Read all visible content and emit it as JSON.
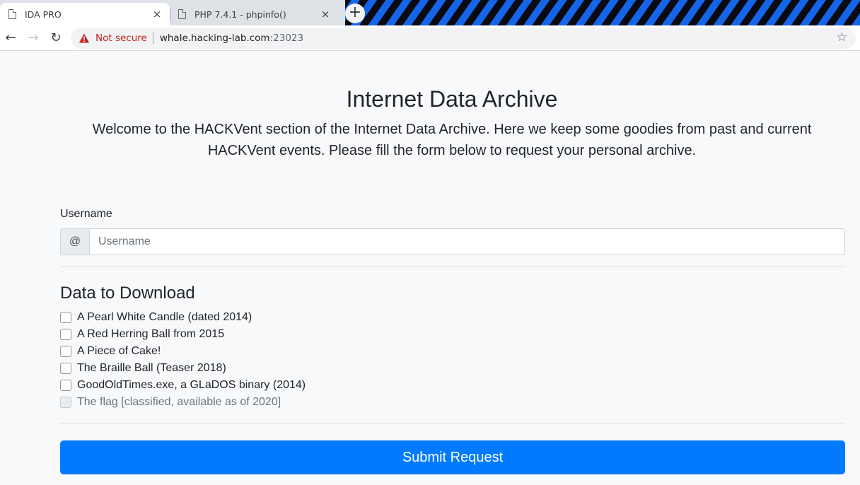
{
  "browser": {
    "tabs": [
      {
        "title": "IDA PRO",
        "active": true
      },
      {
        "title": "PHP 7.4.1 - phpinfo()",
        "active": false
      }
    ],
    "close_glyph": "×",
    "new_tab_glyph": "+",
    "nav": {
      "back_glyph": "←",
      "forward_glyph": "→",
      "reload_glyph": "↻"
    },
    "security_label": "Not secure",
    "url_host": "whale.hacking-lab.com",
    "url_port": ":23023",
    "bookmark_glyph": "☆"
  },
  "page": {
    "title": "Internet Data Archive",
    "lead": "Welcome to the HACKVent section of the Internet Data Archive. Here we keep some goodies from past and current HACKVent events. Please fill the form below to request your personal archive.",
    "username_label": "Username",
    "username_prefix": "@",
    "username_placeholder": "Username",
    "username_value": "",
    "download_title": "Data to Download",
    "items": [
      {
        "label": "A Pearl White Candle (dated 2014)",
        "checked": false,
        "disabled": false
      },
      {
        "label": "A Red Herring Ball from 2015",
        "checked": false,
        "disabled": false
      },
      {
        "label": "A Piece of Cake!",
        "checked": false,
        "disabled": false
      },
      {
        "label": "The Braille Ball (Teaser 2018)",
        "checked": false,
        "disabled": false
      },
      {
        "label": "GoodOldTimes.exe, a GLaDOS binary (2014)",
        "checked": false,
        "disabled": false
      },
      {
        "label": "The flag [classified, available as of 2020]",
        "checked": false,
        "disabled": true
      }
    ],
    "submit_label": "Submit Request"
  },
  "colors": {
    "primary": "#007bff",
    "page_background": "#f8f9fa",
    "warning_red": "#c5221f",
    "tabstrip_stripe_blue": "#1565e9"
  },
  "icons": {
    "tab_favicon": "document-icon",
    "security": "warning-triangle-icon",
    "bookmark": "star-icon"
  }
}
